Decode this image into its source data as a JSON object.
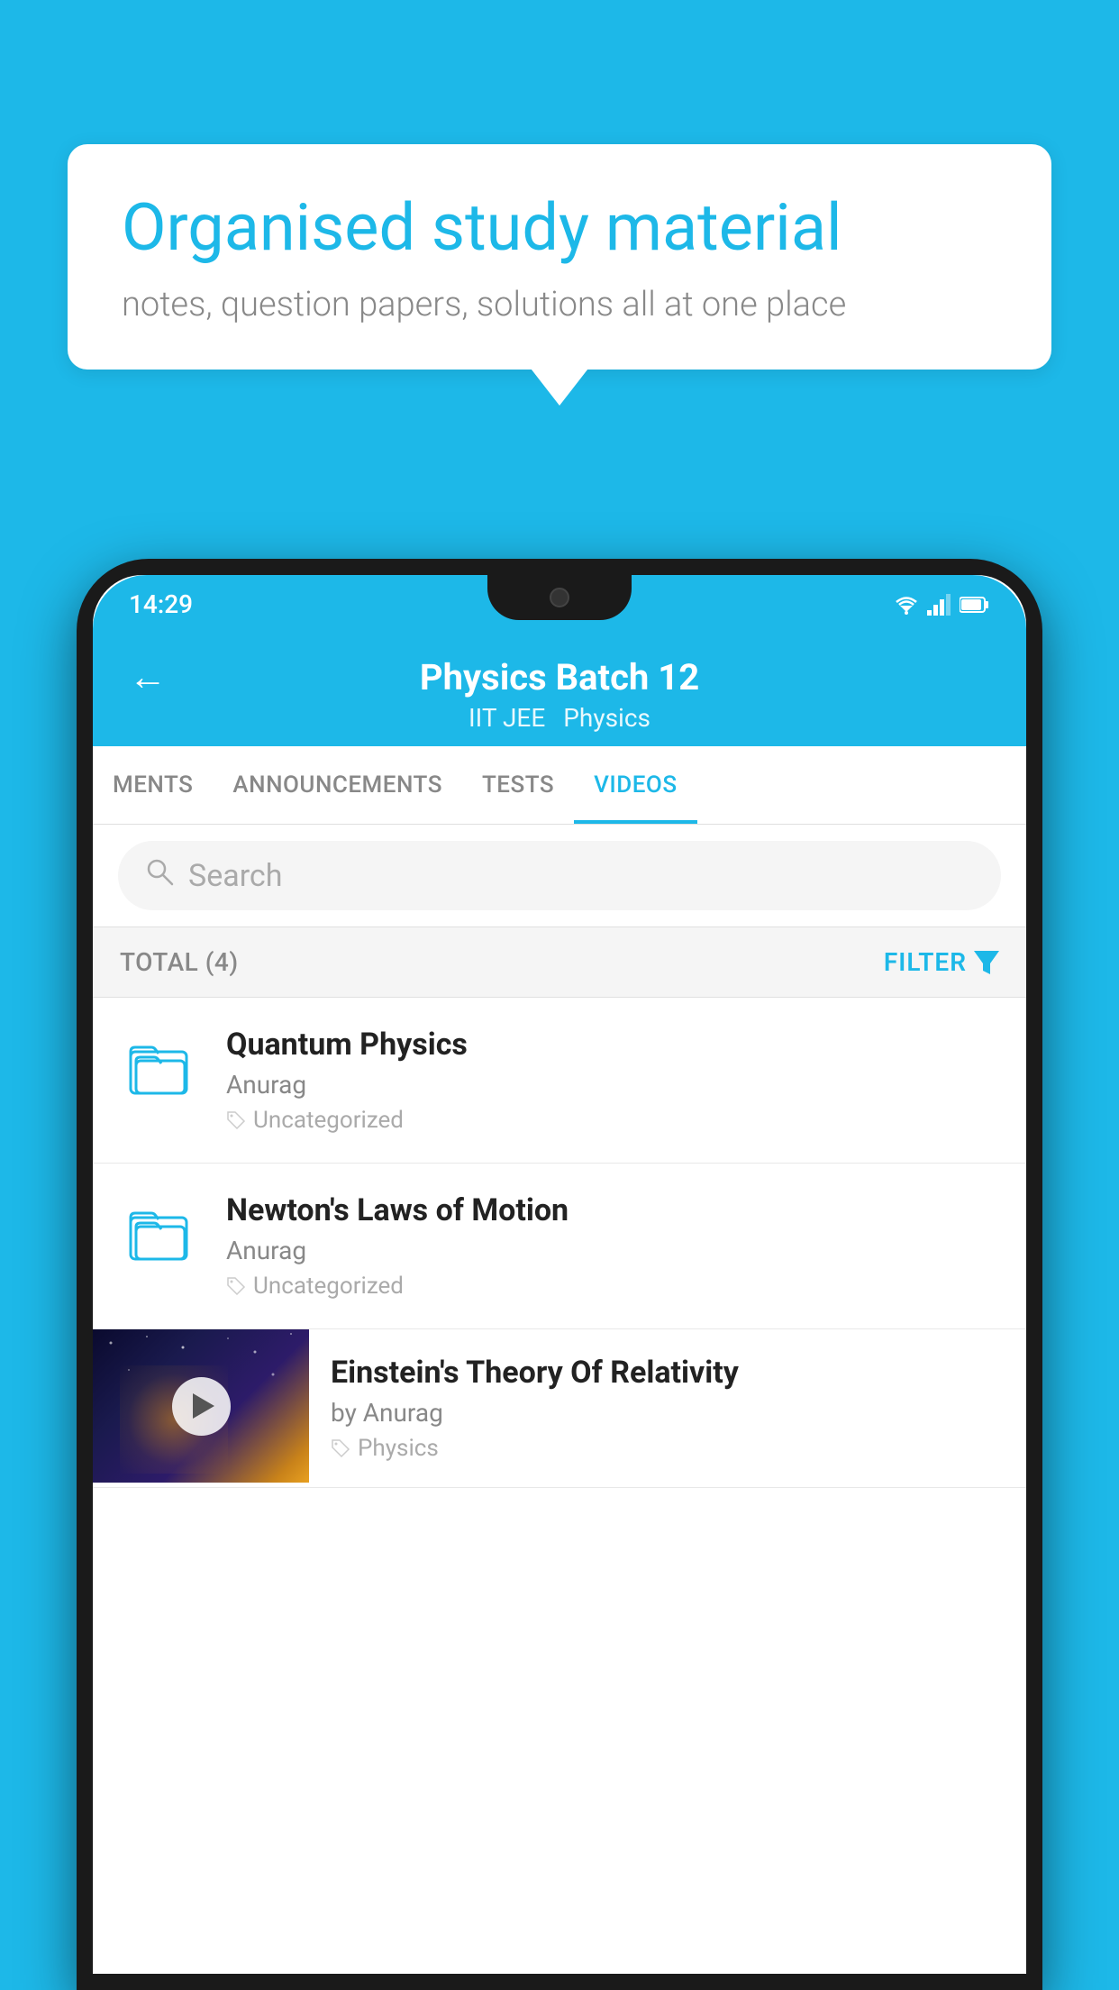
{
  "bubble": {
    "title": "Organised study material",
    "subtitle": "notes, question papers, solutions all at one place"
  },
  "status_bar": {
    "time": "14:29",
    "wifi": "▼",
    "signal": "◀",
    "battery": "▮"
  },
  "header": {
    "back_label": "←",
    "title": "Physics Batch 12",
    "subtitle1": "IIT JEE",
    "subtitle2": "Physics"
  },
  "tabs": [
    {
      "label": "MENTS",
      "active": false
    },
    {
      "label": "ANNOUNCEMENTS",
      "active": false
    },
    {
      "label": "TESTS",
      "active": false
    },
    {
      "label": "VIDEOS",
      "active": true
    }
  ],
  "search": {
    "placeholder": "Search"
  },
  "filter_bar": {
    "total_label": "TOTAL (4)",
    "filter_label": "FILTER"
  },
  "videos": [
    {
      "title": "Quantum Physics",
      "author": "Anurag",
      "tag": "Uncategorized",
      "type": "folder"
    },
    {
      "title": "Newton's Laws of Motion",
      "author": "Anurag",
      "tag": "Uncategorized",
      "type": "folder"
    },
    {
      "title": "Einstein's Theory Of Relativity",
      "author": "by Anurag",
      "tag": "Physics",
      "type": "video"
    }
  ]
}
